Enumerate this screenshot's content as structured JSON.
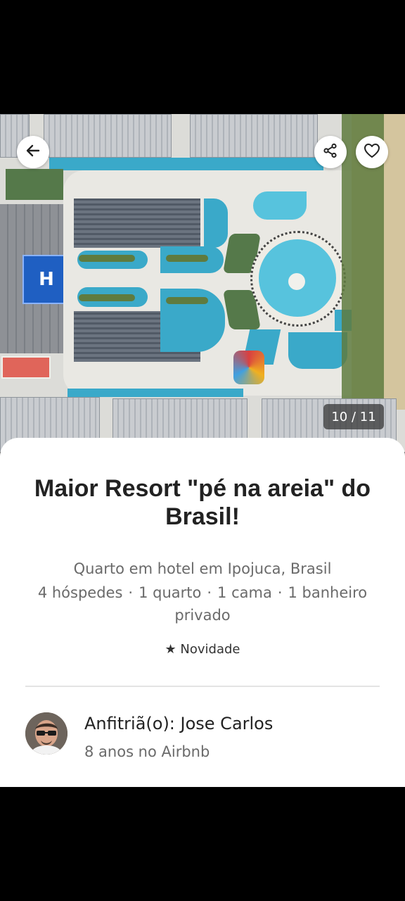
{
  "photo": {
    "counter": "10 / 11",
    "helipad_label": "H"
  },
  "buttons": {
    "back": "back-arrow-icon",
    "share": "share-icon",
    "favorite": "heart-icon"
  },
  "listing": {
    "title": "Maior Resort \"pé na areia\" do Brasil!",
    "subtitle": "Quarto em hotel em Ipojuca, Brasil",
    "guests": "4 hóspedes",
    "rooms": "1 quarto",
    "beds": "1 cama",
    "bath": "1 banheiro privado",
    "separator": "·",
    "badge_icon": "★",
    "badge": "Novidade"
  },
  "host": {
    "name": "Anfitriã(o): Jose Carlos",
    "tenure": "8 anos no Airbnb"
  },
  "colors": {
    "pool": "#3aa9c9",
    "background": "#000000",
    "sheet": "#ffffff"
  }
}
